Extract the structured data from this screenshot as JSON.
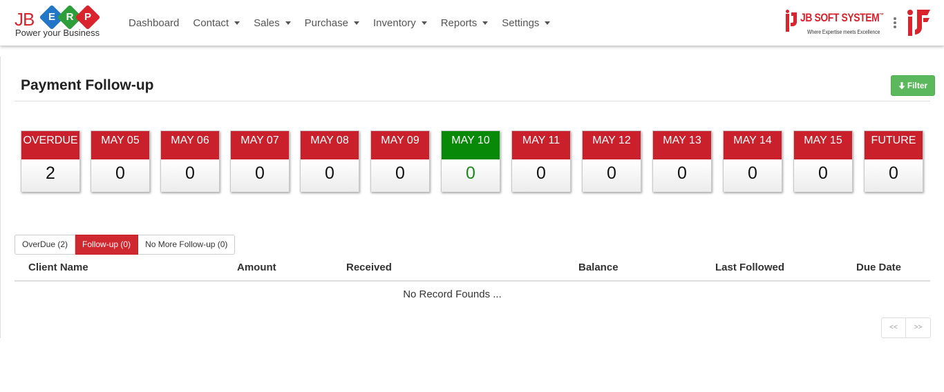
{
  "brand": {
    "prefix": "JB",
    "letters": [
      "E",
      "R",
      "P"
    ],
    "tagline": "Power your Business",
    "colors": {
      "red": "#d9232d",
      "blue": "#2176c7",
      "green": "#2e9e3a"
    }
  },
  "nav": {
    "items": [
      {
        "label": "Dashboard",
        "dropdown": false
      },
      {
        "label": "Contact",
        "dropdown": true
      },
      {
        "label": "Sales",
        "dropdown": true
      },
      {
        "label": "Purchase",
        "dropdown": true
      },
      {
        "label": "Inventory",
        "dropdown": true
      },
      {
        "label": "Reports",
        "dropdown": true
      },
      {
        "label": "Settings",
        "dropdown": true
      }
    ]
  },
  "company": {
    "name": "JB SOFT SYSTEM",
    "trademark": "™",
    "tagline": "Where Expertise meets Excellence",
    "menu_icon": "kebab-vertical-icon"
  },
  "page": {
    "title": "Payment Follow-up",
    "filter_label": "Filter",
    "filter_icon": "arrow-down-icon",
    "accent_red": "#c9202b",
    "accent_green": "#088a08",
    "filter_green": "#5cb85c"
  },
  "date_cards": [
    {
      "label": "OVERDUE",
      "count": "2",
      "active": false
    },
    {
      "label": "MAY 05",
      "count": "0",
      "active": false
    },
    {
      "label": "MAY 06",
      "count": "0",
      "active": false
    },
    {
      "label": "MAY 07",
      "count": "0",
      "active": false
    },
    {
      "label": "MAY 08",
      "count": "0",
      "active": false
    },
    {
      "label": "MAY 09",
      "count": "0",
      "active": false
    },
    {
      "label": "MAY 10",
      "count": "0",
      "active": true
    },
    {
      "label": "MAY 11",
      "count": "0",
      "active": false
    },
    {
      "label": "MAY 12",
      "count": "0",
      "active": false
    },
    {
      "label": "MAY 13",
      "count": "0",
      "active": false
    },
    {
      "label": "MAY 14",
      "count": "0",
      "active": false
    },
    {
      "label": "MAY 15",
      "count": "0",
      "active": false
    },
    {
      "label": "FUTURE",
      "count": "0",
      "active": false
    }
  ],
  "tabs": [
    {
      "label": "OverDue (2)",
      "active": false
    },
    {
      "label": "Follow-up (0)",
      "active": true
    },
    {
      "label": "No More Follow-up (0)",
      "active": false
    }
  ],
  "table": {
    "columns": [
      "Client Name",
      "Amount",
      "Received",
      "Balance",
      "Last Followed",
      "Due Date"
    ],
    "empty_message": "No Record Founds ..."
  },
  "pagination": {
    "prev": "<<",
    "next": ">>"
  }
}
